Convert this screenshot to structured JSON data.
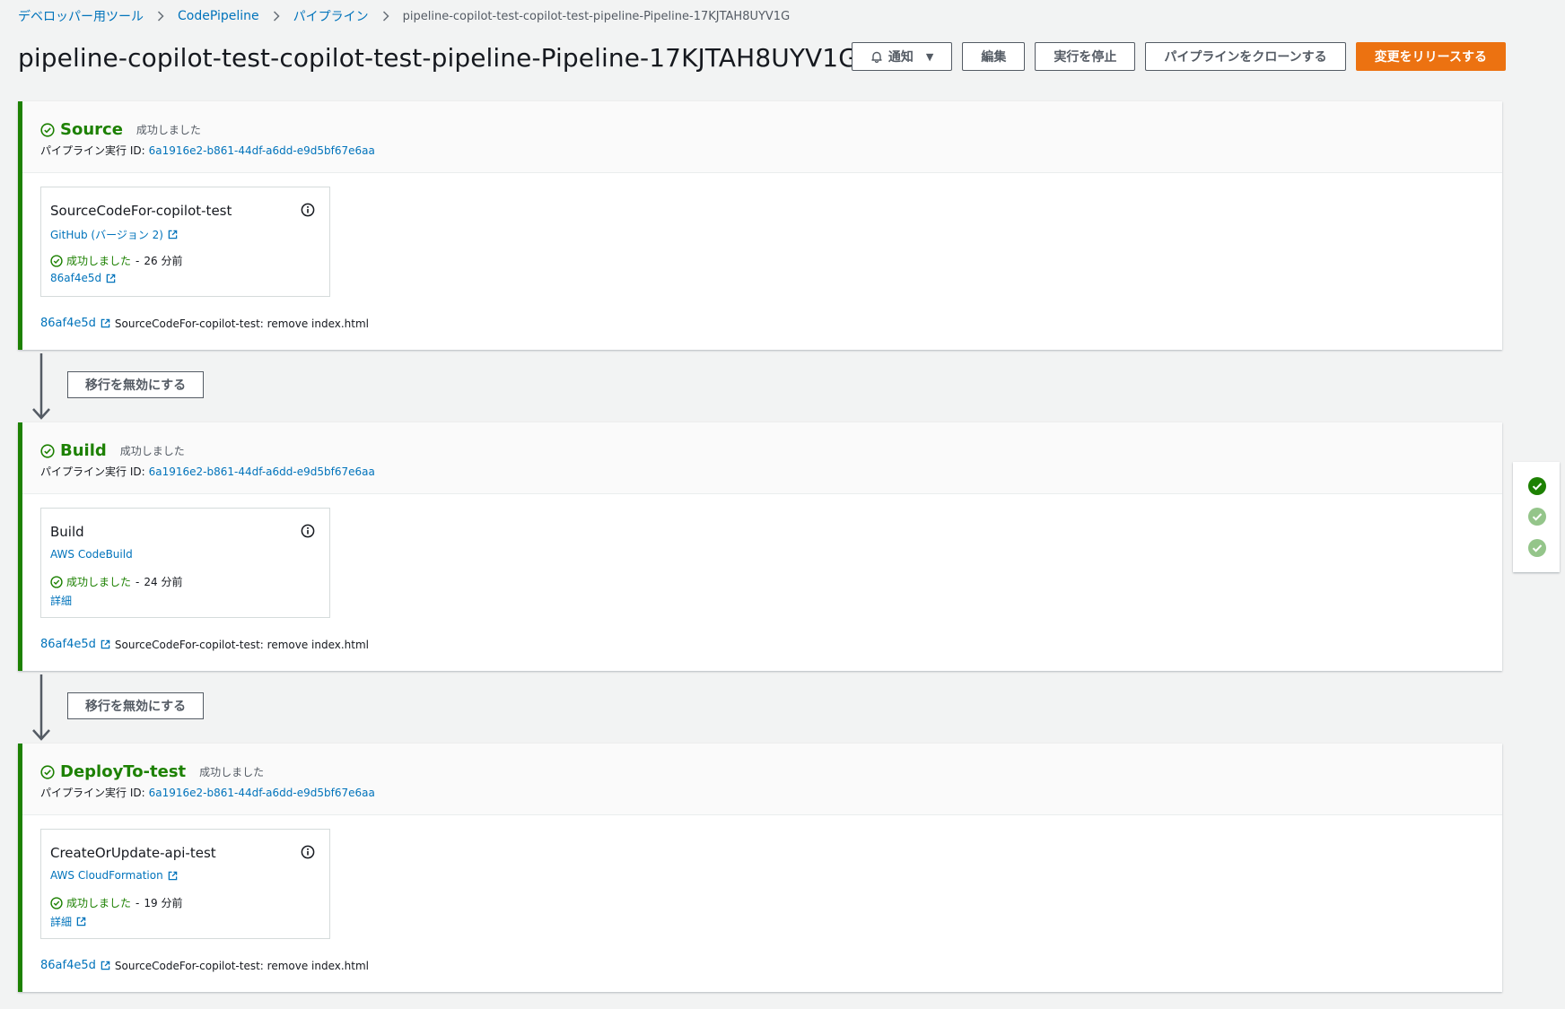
{
  "breadcrumb": {
    "items": [
      "デベロッパー用ツール",
      "CodePipeline",
      "パイプライン"
    ],
    "current": "pipeline-copilot-test-copilot-test-pipeline-Pipeline-17KJTAH8UYV1G"
  },
  "header": {
    "title": "pipeline-copilot-test-copilot-test-pipeline-Pipeline-17KJTAH8UYV1G",
    "notify_label": "通知",
    "edit_label": "編集",
    "stop_label": "実行を停止",
    "clone_label": "パイプラインをクローンする",
    "release_label": "変更をリリースする"
  },
  "colors": {
    "success": "#1d8102",
    "accent": "#ec7211",
    "link": "#0073bb"
  },
  "stages": [
    {
      "name": "Source",
      "status": "成功しました",
      "exec_label": "パイプライン実行 ID:",
      "exec_id": "6a1916e2-b861-44df-a6dd-e9d5bf67e6aa",
      "action": {
        "name": "SourceCodeFor-copilot-test",
        "provider": "GitHub (バージョン 2)",
        "status": "成功しました",
        "time": "26 分前",
        "link": "86af4e5d"
      },
      "commit": {
        "id": "86af4e5d",
        "message": "SourceCodeFor-copilot-test: remove index.html"
      }
    },
    {
      "name": "Build",
      "status": "成功しました",
      "exec_label": "パイプライン実行 ID:",
      "exec_id": "6a1916e2-b861-44df-a6dd-e9d5bf67e6aa",
      "action": {
        "name": "Build",
        "provider": "AWS CodeBuild",
        "status": "成功しました",
        "time": "24 分前",
        "link": "詳細"
      },
      "commit": {
        "id": "86af4e5d",
        "message": "SourceCodeFor-copilot-test: remove index.html"
      }
    },
    {
      "name": "DeployTo-test",
      "status": "成功しました",
      "exec_label": "パイプライン実行 ID:",
      "exec_id": "6a1916e2-b861-44df-a6dd-e9d5bf67e6aa",
      "action": {
        "name": "CreateOrUpdate-api-test",
        "provider": "AWS CloudFormation",
        "status": "成功しました",
        "time": "19 分前",
        "link": "詳細"
      },
      "commit": {
        "id": "86af4e5d",
        "message": "SourceCodeFor-copilot-test: remove index.html"
      }
    }
  ],
  "transitions": [
    {
      "label": "移行を無効にする"
    },
    {
      "label": "移行を無効にする"
    }
  ],
  "minimap": {
    "icons": [
      "check-circle-icon",
      "check-circle-icon",
      "check-circle-icon"
    ]
  }
}
